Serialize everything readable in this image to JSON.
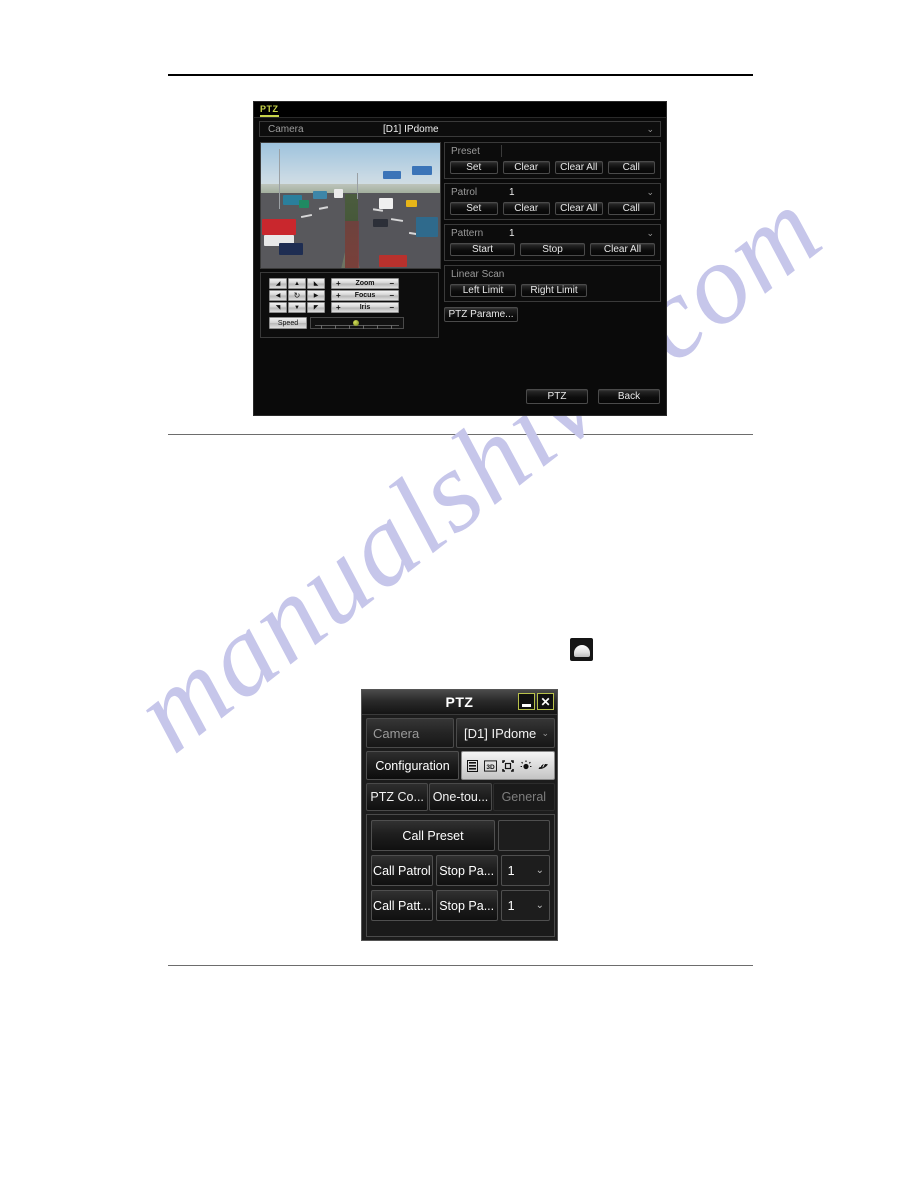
{
  "page": {
    "watermark_text": "manualshive.com",
    "watermark_color": "#c6c6ea"
  },
  "ptz_settings_panel": {
    "tab_label": "PTZ",
    "camera": {
      "label": "Camera",
      "value": "[D1] IPdome",
      "caret": "chevron-down-icon"
    },
    "controls": {
      "dpad": [
        "arrow-up-left",
        "arrow-up",
        "arrow-up-right",
        "arrow-left",
        "auto-rotate",
        "arrow-right",
        "arrow-down-left",
        "arrow-down",
        "arrow-down-right"
      ],
      "lens": [
        {
          "name": "Zoom",
          "minus": "-",
          "plus": "+"
        },
        {
          "name": "Focus",
          "minus": "-",
          "plus": "+"
        },
        {
          "name": "Iris",
          "minus": "-",
          "plus": "+"
        }
      ],
      "speed_label": "Speed"
    },
    "preset": {
      "label": "Preset",
      "value": "",
      "buttons": [
        "Set",
        "Clear",
        "Clear All",
        "Call"
      ]
    },
    "patrol": {
      "label": "Patrol",
      "value": "1",
      "buttons": [
        "Set",
        "Clear",
        "Clear All",
        "Call"
      ]
    },
    "pattern": {
      "label": "Pattern",
      "value": "1",
      "buttons": [
        "Start",
        "Stop",
        "Clear All"
      ]
    },
    "linear_scan": {
      "label": "Linear Scan",
      "buttons": [
        "Left Limit",
        "Right Limit"
      ]
    },
    "ptz_parameters_button": "PTZ Parame...",
    "footer": {
      "ptz_button": "PTZ",
      "back_button": "Back"
    }
  },
  "dome_icon": {
    "name": "ptz-dome-camera-icon"
  },
  "ptz_dialog": {
    "title": "PTZ",
    "window_buttons": {
      "minimize": "minimize-icon",
      "close": "✕"
    },
    "camera": {
      "label": "Camera",
      "value": "[D1] IPdome",
      "caret": "chevron-down-icon"
    },
    "configuration": {
      "label": "Configuration",
      "icons": [
        "menu-list-icon",
        "3d-positioning-icon",
        "center-frame-icon",
        "light-icon",
        "wiper-icon"
      ],
      "icon_labels": [
        "▤",
        "3D",
        "⬚",
        "☀",
        "◠"
      ]
    },
    "tabs": [
      {
        "label": "PTZ Co...",
        "active": true
      },
      {
        "label": "One-tou...",
        "active": true
      },
      {
        "label": "General",
        "active": false
      }
    ],
    "rows": [
      {
        "buttons": [
          "Call Preset"
        ],
        "input_value": ""
      },
      {
        "buttons": [
          "Call Patrol",
          "Stop Pa..."
        ],
        "input_value": "1"
      },
      {
        "buttons": [
          "Call Patt...",
          "Stop Pa..."
        ],
        "input_value": "1"
      }
    ]
  }
}
